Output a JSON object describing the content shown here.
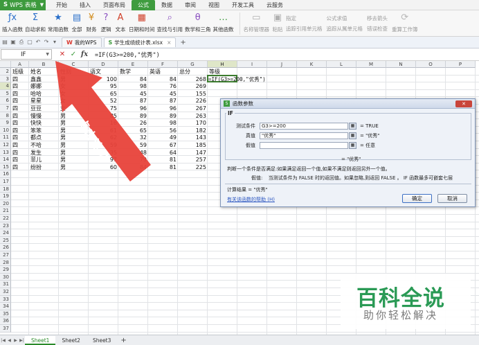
{
  "app": {
    "name": "WPS 表格"
  },
  "menu": {
    "tabs": [
      "开始",
      "插入",
      "页面布局",
      "公式",
      "数据",
      "审阅",
      "视图",
      "开发工具",
      "云服务"
    ],
    "active": "公式"
  },
  "ribbon": {
    "buttons": [
      {
        "label": "插入函数",
        "icon": "fx-icon"
      },
      {
        "label": "自动求和",
        "icon": "sigma-icon"
      },
      {
        "label": "常用函数",
        "icon": "star-icon"
      },
      {
        "label": "全部",
        "icon": "function-list-icon"
      },
      {
        "label": "财务",
        "icon": "money-icon"
      },
      {
        "label": "逻辑",
        "icon": "logic-icon"
      },
      {
        "label": "文本",
        "icon": "text-icon"
      },
      {
        "label": "日期和时间",
        "icon": "calendar-icon"
      },
      {
        "label": "查找与引用",
        "icon": "lookup-icon"
      },
      {
        "label": "数学和三角",
        "icon": "math-icon"
      },
      {
        "label": "其他函数",
        "icon": "more-functions-icon"
      },
      {
        "label": "名称管理器",
        "icon": "name-manager-icon"
      },
      {
        "label": "粘贴",
        "icon": "paste-icon"
      }
    ],
    "small": [
      "指定",
      "追踪引用单元格",
      "公式求值",
      "追踪从属单元格",
      "移去箭头",
      "错误检查"
    ],
    "right": "重算工作簿"
  },
  "tabbar": {
    "tabs": [
      {
        "label": "我的WPS",
        "icon": "wps-icon"
      },
      {
        "label": "学生成绩统计表.xlsx",
        "icon": "spreadsheet-icon"
      }
    ]
  },
  "formula_bar": {
    "name_box": "IF",
    "formula": "=IF(G3>=200,\"优秀\")",
    "fx": "fx"
  },
  "grid": {
    "columns": [
      "A",
      "B",
      "C",
      "D",
      "E",
      "F",
      "G",
      "H",
      "I",
      "J",
      "K",
      "L",
      "M",
      "N",
      "O",
      "P"
    ],
    "selected_column": "H",
    "row_count": 36,
    "selected_row": 3,
    "header": [
      "班级",
      "姓名",
      "性别",
      "语文",
      "数学",
      "英语",
      "总分",
      "等级"
    ],
    "rows": [
      [
        "四",
        "鑫鑫",
        "男",
        "100",
        "84",
        "84",
        "268"
      ],
      [
        "四",
        "娜娜",
        "女",
        "95",
        "98",
        "76",
        "269"
      ],
      [
        "四",
        "哈哈",
        "女",
        "65",
        "45",
        "45",
        "155"
      ],
      [
        "四",
        "星星",
        "女",
        "52",
        "87",
        "87",
        "226"
      ],
      [
        "四",
        "豆豆",
        "女",
        "75",
        "96",
        "96",
        "267"
      ],
      [
        "四",
        "慢慢",
        "男",
        "85",
        "89",
        "89",
        "263"
      ],
      [
        "四",
        "快快",
        "男",
        "16",
        "26",
        "98",
        "170"
      ],
      [
        "四",
        "笨笨",
        "男",
        "61",
        "65",
        "56",
        "182"
      ],
      [
        "四",
        "都点",
        "男",
        "62",
        "32",
        "49",
        "143"
      ],
      [
        "四",
        "不哈",
        "男",
        "59",
        "59",
        "67",
        "185"
      ],
      [
        "四",
        "发生",
        "男",
        "35",
        "48",
        "64",
        "147"
      ],
      [
        "四",
        "菲儿",
        "男",
        "97",
        "79",
        "81",
        "257"
      ],
      [
        "四",
        "纷扮",
        "男",
        "60",
        "84",
        "81",
        "225"
      ]
    ],
    "active_cell_text": "=IF(G3>=200,\"优秀\")"
  },
  "annotation": {
    "text": "点击这处",
    "color": "#e8423a"
  },
  "dialog": {
    "title": "函数参数",
    "function": "IF",
    "close": "✕",
    "args": [
      {
        "label": "测试条件",
        "value": "G3>=200",
        "result": "= TRUE"
      },
      {
        "label": "真值",
        "value": "\"优秀\"",
        "result": "= \"优秀\""
      },
      {
        "label": "假值",
        "value": "",
        "result": "= 任意"
      }
    ],
    "total": "= \"优秀\"",
    "description": "判断一个条件是否满足:如果满足返回一个值,如果不满足则返回另外一个值。",
    "arg_desc_label": "假值:",
    "arg_desc": "当测试条件为 FALSE 时的返回值。如果忽略,则返回 FALSE 。 IF 函数最多可嵌套七层",
    "result_line": "计算结果 = \"优秀\"",
    "help": "有关该函数的帮助 (H)",
    "ok": "确定",
    "cancel": "取消"
  },
  "sheets": {
    "tabs": [
      "Sheet1",
      "Sheet2",
      "Sheet3"
    ],
    "active": "Sheet1"
  },
  "watermark": {
    "title": "百科全说",
    "subtitle": "助你轻松解决"
  }
}
